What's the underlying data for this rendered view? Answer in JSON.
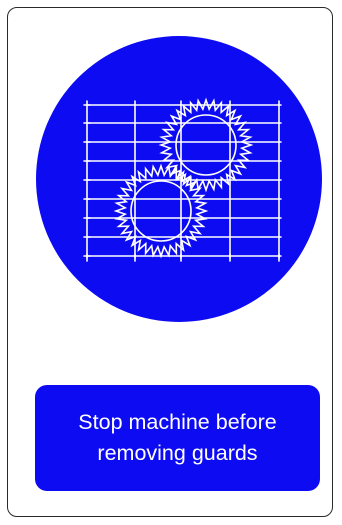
{
  "sign": {
    "caption": "Stop machine before removing guards",
    "icon": "machine-guard-gears-icon",
    "colors": {
      "background": "#ffffff",
      "border": "#2a2a2a",
      "mandatory_blue": "#0d0bf2",
      "symbol": "#ffffff",
      "text": "#ffffff"
    }
  }
}
